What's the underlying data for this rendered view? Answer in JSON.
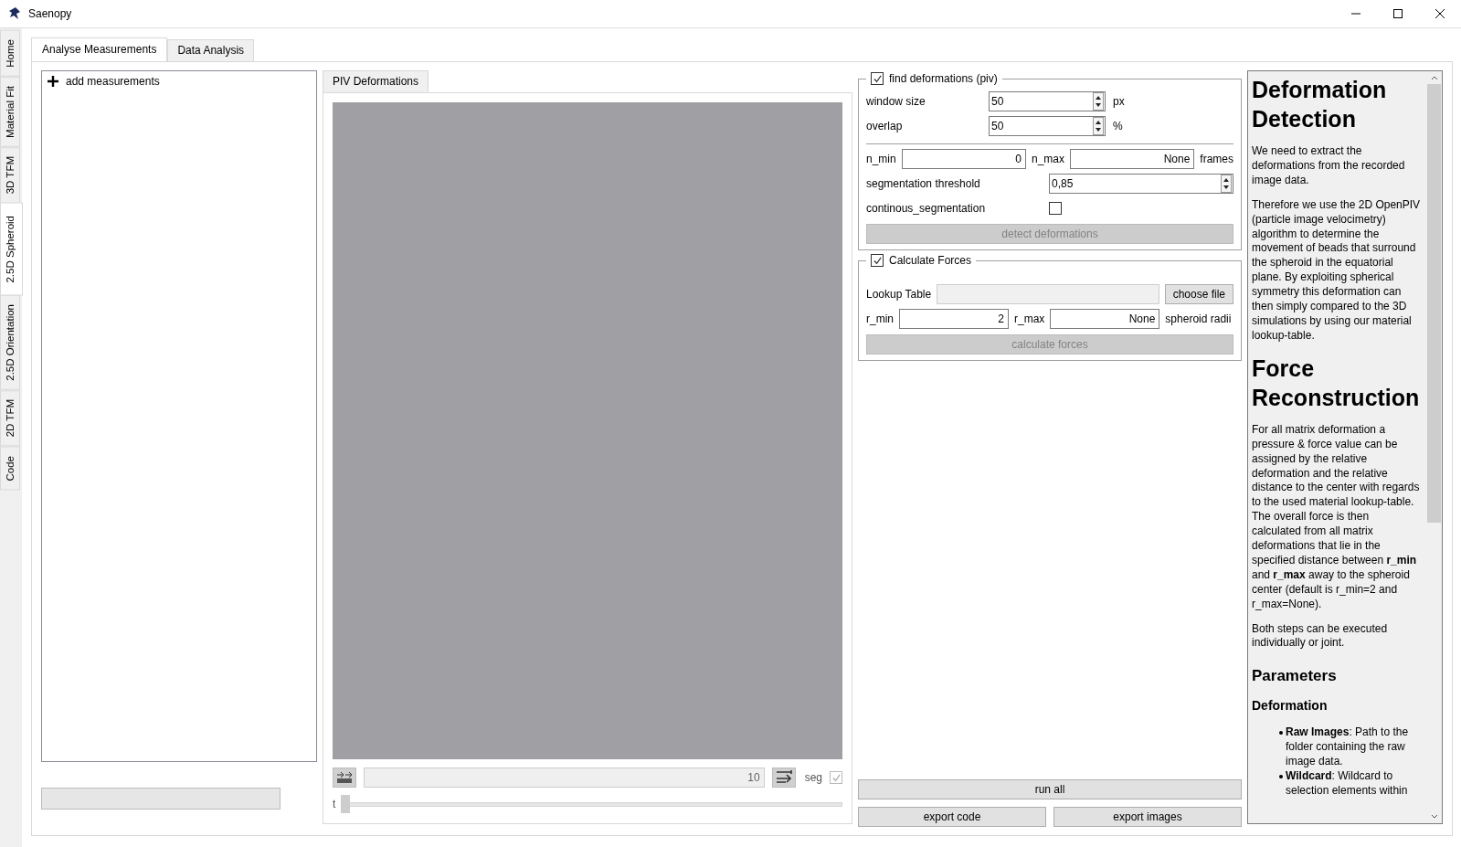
{
  "window": {
    "title": "Saenopy"
  },
  "side_tabs": [
    {
      "label": "Home",
      "selected": false
    },
    {
      "label": "Material Fit",
      "selected": false
    },
    {
      "label": "3D TFM",
      "selected": false
    },
    {
      "label": "2.5D Spheroid",
      "selected": true
    },
    {
      "label": "2.5D Orientation",
      "selected": false
    },
    {
      "label": "2D TFM",
      "selected": false
    },
    {
      "label": "Code",
      "selected": false
    }
  ],
  "main_tabs": [
    {
      "label": "Analyse Measurements",
      "selected": true
    },
    {
      "label": "Data Analysis",
      "selected": false
    }
  ],
  "measurements": {
    "add_label": "add measurements"
  },
  "progress": {
    "level": 0
  },
  "view_tabs": [
    {
      "label": "PIV Deformations"
    }
  ],
  "player": {
    "frame": "10",
    "seg_label": "seg",
    "seg_checked": true,
    "time_label": "t",
    "level": 0
  },
  "find_deformations": {
    "checked": true,
    "label": "find deformations (piv)",
    "window_size": {
      "label": "window size",
      "value": "50",
      "unit": "px"
    },
    "overlap": {
      "label": "overlap",
      "value": "50",
      "unit": "%"
    },
    "n_min": {
      "label": "n_min",
      "value": "0"
    },
    "n_max": {
      "label": "n_max",
      "value": "None"
    },
    "frames_unit": "frames",
    "segmentation_threshold": {
      "label": "segmentation threshold",
      "value": "0,85"
    },
    "continous_segmentation": {
      "label": "continous_segmentation",
      "checked": false
    },
    "button": {
      "label": "detect deformations",
      "disabled": true
    }
  },
  "calculate_forces": {
    "checked": true,
    "label": "Calculate Forces",
    "lookup_table": {
      "label": "Lookup Table"
    },
    "choose_button": "choose file",
    "r_min": {
      "label": "r_min",
      "value": "2"
    },
    "r_max": {
      "label": "r_max",
      "value": "None"
    },
    "unit": "spheroid radii",
    "button": {
      "label": "calculate forces",
      "disabled": true
    }
  },
  "actions": {
    "run_all": "run all",
    "export_code": "export code",
    "export_images": "export images"
  },
  "help": [
    {
      "kind": "h1",
      "text": "Deformation Detection"
    },
    {
      "kind": "p",
      "text": "We need to extract the deformations from the recorded image data."
    },
    {
      "kind": "p",
      "text": "Therefore we use the 2D OpenPIV (particle image velocimetry) algorithm to determine the movement of beads that surround the spheroid in the equatorial plane. By exploiting spherical symmetry this deformation can then simply compared to the 3D simulations by using our material lookup-table."
    },
    {
      "kind": "h1",
      "text": "Force Reconstruction"
    },
    {
      "kind": "p",
      "text": "For all matrix deformation a pressure & force value can be assigned by the relative deformation and the relative distance to the center with regards to the used material lookup-table. The overall force is then calculated from all matrix deformations that lie in the specified distance between **r_min** and **r_max** away to the spheroid center (default is r_min=2 and r_max=None)."
    },
    {
      "kind": "p",
      "text": "Both steps can be executed individually or joint."
    },
    {
      "kind": "h2",
      "text": "Parameters"
    },
    {
      "kind": "h3",
      "text": "Deformation"
    },
    {
      "kind": "ul",
      "items": [
        "**Raw Images**: Path to the folder containing the raw image data.",
        "**Wildcard**: Wildcard to selection elements within"
      ]
    }
  ]
}
